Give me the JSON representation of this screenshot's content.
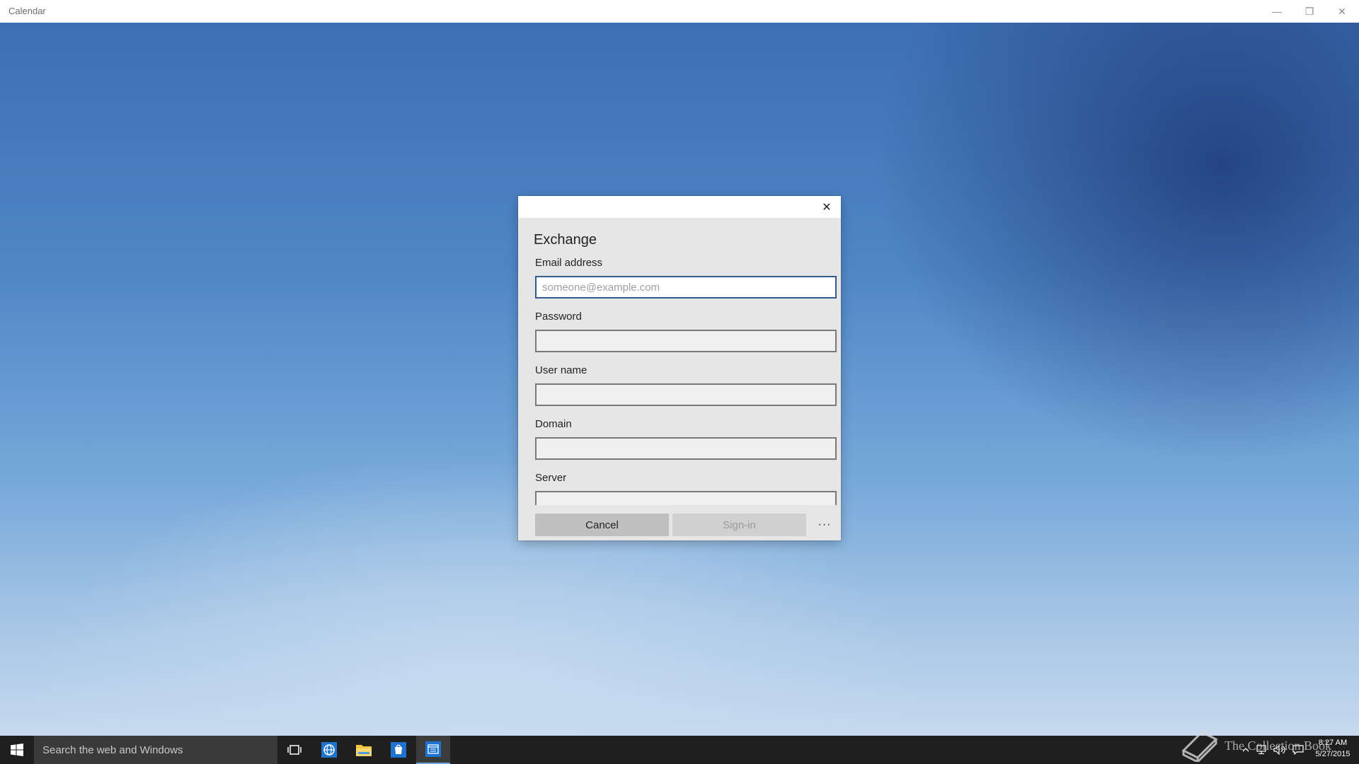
{
  "window": {
    "title": "Calendar",
    "minimize_glyph": "—",
    "maximize_glyph": "❐",
    "close_glyph": "✕"
  },
  "dialog": {
    "title": "Exchange",
    "close_glyph": "✕",
    "fields": {
      "email": {
        "label": "Email address",
        "value": "",
        "placeholder": "someone@example.com"
      },
      "password": {
        "label": "Password",
        "value": ""
      },
      "username": {
        "label": "User name",
        "value": ""
      },
      "domain": {
        "label": "Domain",
        "value": ""
      },
      "server": {
        "label": "Server",
        "value": ""
      }
    },
    "buttons": {
      "cancel": "Cancel",
      "signin": "Sign-in",
      "more": "···"
    }
  },
  "taskbar": {
    "search_placeholder": "Search the web and Windows",
    "icons": [
      "windows-start-icon",
      "task-view-icon",
      "edge-browser-icon",
      "file-explorer-icon",
      "store-icon",
      "calendar-app-icon"
    ],
    "clock_time": "8:27 AM",
    "clock_date": "5/27/2015",
    "tray_icons": [
      "chevron-up-icon",
      "network-icon",
      "volume-icon",
      "action-center-icon"
    ]
  },
  "watermark": {
    "text": "The Collection Book",
    "icon": "book-icon"
  },
  "colors": {
    "focus_border": "#315c8d",
    "taskbar": "#1f1f1f",
    "dialog_bg": "#e6e6e6"
  }
}
